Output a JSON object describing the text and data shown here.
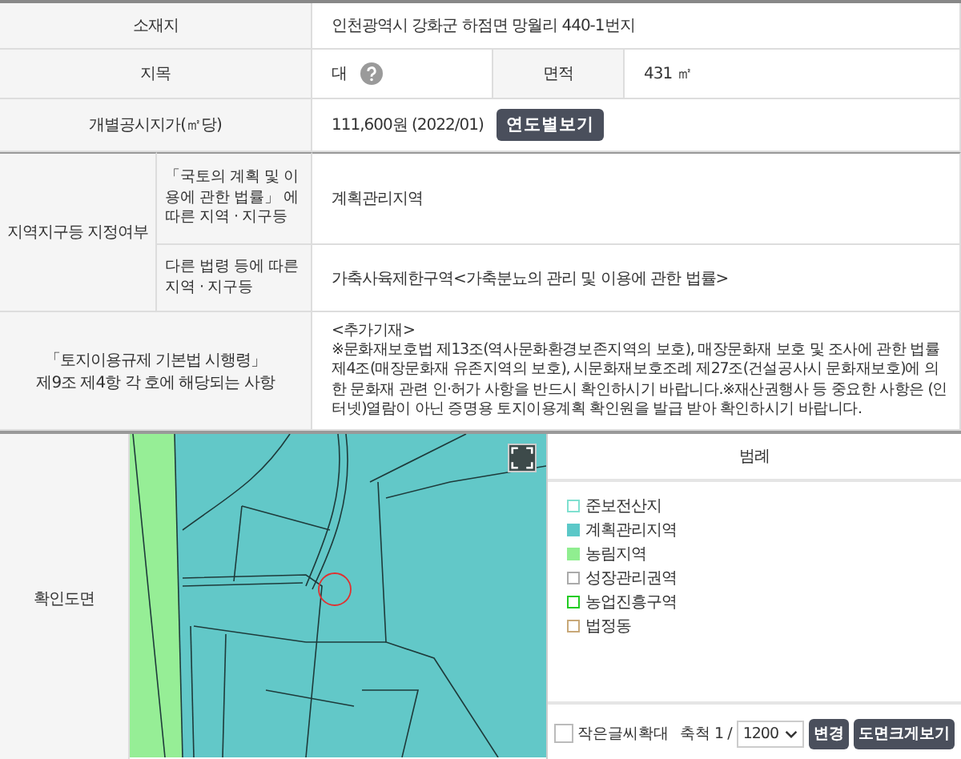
{
  "address": {
    "label": "소재지",
    "value": "인천광역시 강화군 하점면 망월리 440-1번지"
  },
  "land_category": {
    "label": "지목",
    "value": "대"
  },
  "area": {
    "label": "면적",
    "value": "431 ㎡"
  },
  "price": {
    "label": "개별공시지가(㎡당)",
    "value": "111,600원 (2022/01)",
    "button": "연도별보기"
  },
  "zoning": {
    "label": "지역지구등 지정여부",
    "items": [
      {
        "label": "「국토의 계획 및 이용에 관한 법률」 에 따른 지역 · 지구등",
        "value": "계획관리지역"
      },
      {
        "label": "다른 법령 등에 따른 지역 · 지구등",
        "value": "가축사육제한구역<가축분뇨의 관리 및 이용에 관한 법률>"
      }
    ]
  },
  "regulation": {
    "label_lines": [
      "「토지이용규제 기본법 시행령」",
      "제9조 제4항 각 호에 해당되는 사항"
    ],
    "heading": "<추가기재>",
    "body": "※문화재보호법 제13조(역사문화환경보존지역의 보호), 매장문화재 보호 및 조사에 관한 법률 제4조(매장문화재 유존지역의 보호), 시문화재보호조례 제27조(건설공사시 문화재보호)에 의한 문화재 관련 인·허가 사항을 반드시 확인하시기 바랍니다.※재산권행사 등 중요한 사항은 (인터넷)열람이 아닌 증명용 토지이용계획 확인원을 발급 받아 확인하시기 바랍니다."
  },
  "map": {
    "label": "확인도면"
  },
  "legend": {
    "title": "범례",
    "items": [
      {
        "label": "준보전산지",
        "kind": "outline",
        "color": "#7fe0d0"
      },
      {
        "label": "계획관리지역",
        "kind": "filled",
        "color": "#5bc8c8"
      },
      {
        "label": "농림지역",
        "kind": "filled",
        "color": "#90ee90"
      },
      {
        "label": "성장관리권역",
        "kind": "outline",
        "color": "#aaaaaa"
      },
      {
        "label": "농업진흥구역",
        "kind": "outline",
        "color": "#22cc22"
      },
      {
        "label": "법정동",
        "kind": "outline",
        "color": "#c8a878"
      }
    ]
  },
  "controls": {
    "enlarge": {
      "label": "작은글씨확대",
      "checked": false
    },
    "scale_label": "축척 1 /",
    "scale": "1200",
    "buttons": [
      "변경",
      "도면크게보기"
    ]
  }
}
